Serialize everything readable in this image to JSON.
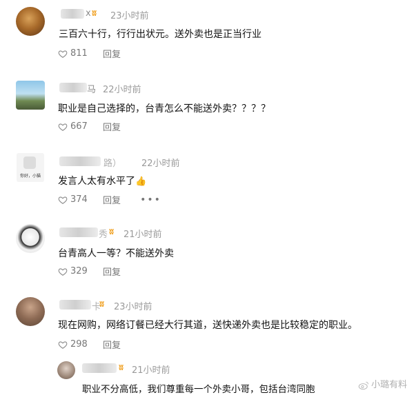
{
  "comments": [
    {
      "name_suffix": "x",
      "time": "23小时前",
      "text": "三百六十行，行行出状元。送外卖也是正当行业",
      "likes": "811",
      "reply_label": "回复",
      "verified": true
    },
    {
      "name_suffix": "马",
      "time": "22小时前",
      "text": "职业是自己选择的，台青怎么不能送外卖？？？？",
      "likes": "667",
      "reply_label": "回复",
      "verified": false
    },
    {
      "name_suffix": "路）",
      "time": "22小时前",
      "text": "发言人太有水平了",
      "emoji": "👍",
      "likes": "374",
      "reply_label": "回复",
      "more": "•••",
      "avatar_caption": "你好，小猫",
      "verified": false
    },
    {
      "name_suffix": "秀",
      "time": "21小时前",
      "text": "台青高人一等？不能送外卖",
      "likes": "329",
      "reply_label": "回复",
      "verified": true
    },
    {
      "name_suffix": "卡",
      "time": "23小时前",
      "text": "现在网购，网络订餐已经大行其道，送快递外卖也是比较稳定的职业。",
      "likes": "298",
      "reply_label": "回复",
      "verified": true
    }
  ],
  "nested_reply": {
    "time": "21小时前",
    "text": "职业不分高低，我们尊重每一个外卖小哥，包括台湾同胞"
  },
  "watermark": "小璐有料",
  "colors": {
    "badge": "#f0a020",
    "muted": "#9a9a9a",
    "text": "#111111"
  }
}
